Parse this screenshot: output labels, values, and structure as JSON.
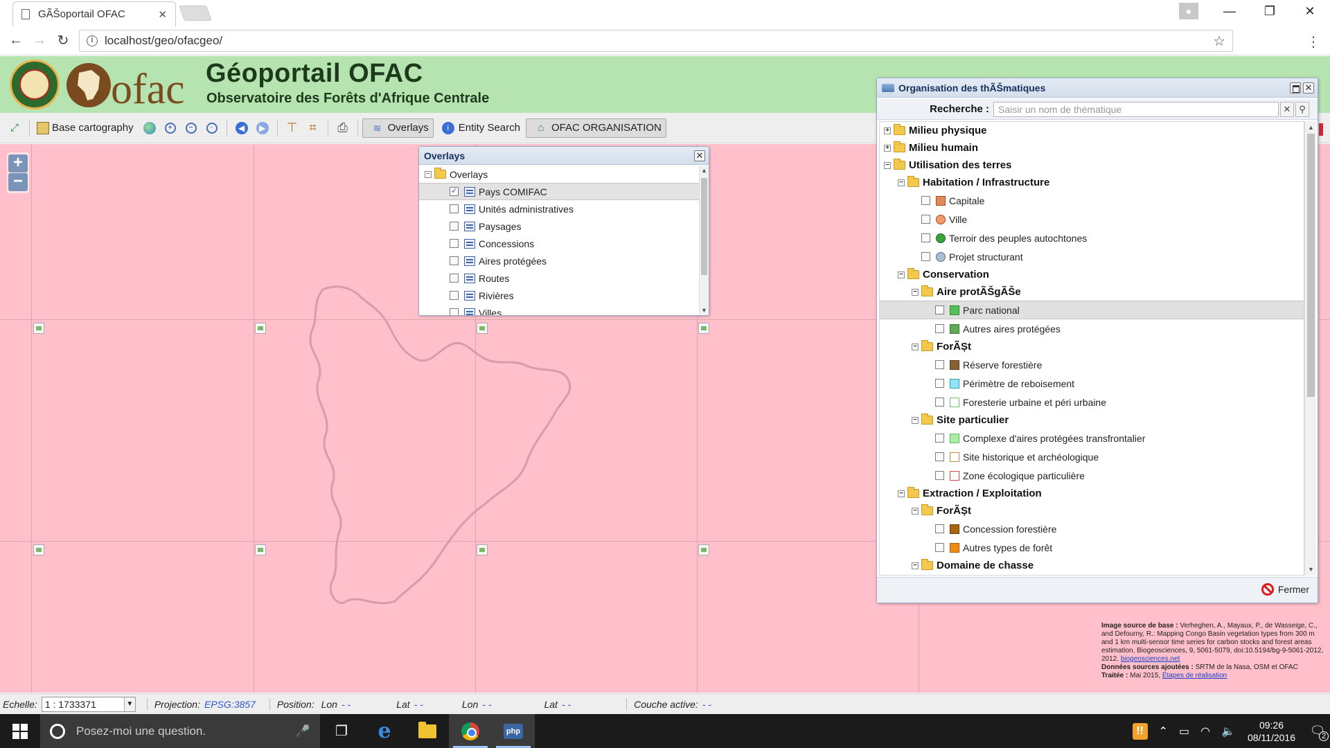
{
  "browser": {
    "tab_title": "GÃŠoportail OFAC",
    "url": "localhost/geo/ofacgeo/"
  },
  "header": {
    "title": "Géoportail OFAC",
    "subtitle": "Observatoire des Forêts d'Afrique Centrale",
    "logo_text": "ofac"
  },
  "toolbar": {
    "base_cartography": "Base cartography",
    "overlays": "Overlays",
    "entity_search": "Entity Search",
    "ofac_organisation": "OFAC ORGANISATION"
  },
  "overlays_window": {
    "title": "Overlays",
    "root": "Overlays",
    "layers": [
      {
        "label": "Pays COMIFAC",
        "checked": true
      },
      {
        "label": "Unités administratives",
        "checked": false
      },
      {
        "label": "Paysages",
        "checked": false
      },
      {
        "label": "Concessions",
        "checked": false
      },
      {
        "label": "Aires protégées",
        "checked": false
      },
      {
        "label": "Routes",
        "checked": false
      },
      {
        "label": "Rivières",
        "checked": false
      },
      {
        "label": "Villes",
        "checked": false
      }
    ]
  },
  "theme_window": {
    "title": "Organisation des thÃŠmatiques",
    "search_label": "Recherche :",
    "search_placeholder": "Saisir un nom de thématique",
    "close_label": "Fermer",
    "tree": {
      "milieu_physique": "Milieu physique",
      "milieu_humain": "Milieu humain",
      "utilisation": "Utilisation des terres",
      "habitation": "Habitation / Infrastructure",
      "capitale": "Capitale",
      "ville": "Ville",
      "terroir": "Terroir des peuples autochtones",
      "projet": "Projet structurant",
      "conservation": "Conservation",
      "aire_protegee": "Aire protÃŠgÃŠe",
      "parc_national": "Parc national",
      "autres_aires": "Autres aires protégées",
      "foret_1": "ForÃȘt",
      "reserve": "Réserve forestière",
      "perimetre": "Périmètre de reboisement",
      "foresterie": "Foresterie urbaine et péri urbaine",
      "site_particulier": "Site particulier",
      "complexe": "Complexe d'aires protégées transfrontalier",
      "site_historique": "Site historique et archéologique",
      "zone_ecologique": "Zone écologique particulière",
      "extraction": "Extraction / Exploitation",
      "foret_2": "ForÃȘt",
      "concession_forestiere": "Concession forestière",
      "autres_foret": "Autres types de forêt",
      "domaine_chasse": "Domaine de chasse"
    },
    "colors": {
      "capitale": "#e08a5a",
      "ville": "#f09a6a",
      "terroir": "#3ba33b",
      "projet": "#a6c0d8",
      "parc_national": "#53c05b",
      "autres_aires": "#5faa54",
      "reserve": "#8a6130",
      "perimetre": "#8fe4f5",
      "foresterie": "#ffffff",
      "complexe": "#a8eea2",
      "site_historique": "#ffffff",
      "zone_ecologique": "#ffffff",
      "concession_forestiere": "#a8650d",
      "autres_foret": "#f08c10"
    }
  },
  "attribution": {
    "base_label": "Image source de base :",
    "base_text": "Verheghen, A., Mayaux, P., de Wasseige, C., and Defourny, R.: Mapping Congo Basin vegetation types from 300 m and 1 km multi-sensor time series for carbon stocks and forest areas estimation, Biogeosciences, 9, 5061-5079, doi:10.5194/bg-9-5061-2012, 2012.",
    "base_link": "biogeosciences.net",
    "added_label": "Données sources ajoutées :",
    "added_text": "SRTM de la Nasa, OSM et OFAC",
    "treated_label": "Traitée :",
    "treated_text": "Mai 2015,",
    "treated_link": "Étapes de réalisation"
  },
  "statusbar": {
    "scale_label": "Echelle:",
    "scale_value": "1 : 1733371",
    "projection_label": "Projection:",
    "projection_value": "EPSG:3857",
    "position_label": "Position:",
    "lon_label": "Lon",
    "lon_value": "- -",
    "lat_label": "Lat",
    "lat_value": "- -",
    "lon2_label": "Lon",
    "lon2_value": "- -",
    "lat2_label": "Lat",
    "lat2_value": "- -",
    "active_layer_label": "Couche active:",
    "active_layer_value": "- -"
  },
  "taskbar": {
    "search_placeholder": "Posez-moi une question.",
    "time": "09:26",
    "date": "08/11/2016",
    "notification_count": "2"
  }
}
